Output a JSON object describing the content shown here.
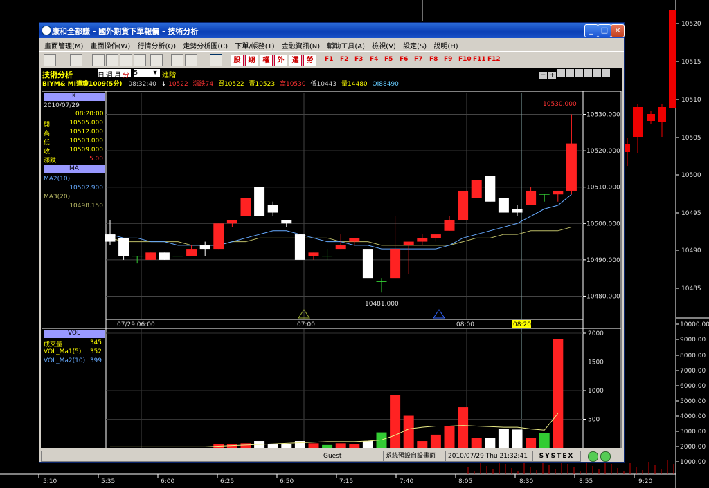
{
  "window": {
    "title": "康和全都賺 - 國外期貨下單報價 - 技術分析",
    "btn_min": "_",
    "btn_max": "□",
    "btn_close": "×"
  },
  "menu": [
    "畫面管理(M)",
    "畫面操作(W)",
    "行情分析(Q)",
    "走勢分析圖(C)",
    "下單/帳務(T)",
    "金融資訊(N)",
    "輔助工具(A)",
    "檢視(V)",
    "設定(S)",
    "說明(H)"
  ],
  "toolbar": {
    "red_buttons": [
      "股",
      "期",
      "權",
      "外",
      "選",
      "勞"
    ],
    "fkeys": [
      "F1",
      "F2",
      "F3",
      "F4",
      "F5",
      "F6",
      "F7",
      "F8",
      "F9",
      "F10",
      "F11",
      "F12"
    ]
  },
  "header": {
    "tech_label": "技術分析",
    "period_options": [
      "日",
      "週",
      "月",
      "分"
    ],
    "period_value": "5",
    "advanced_label": "進階",
    "symbol": "BIYM& MI道瓊1009(5分)",
    "time": "08:32:40",
    "arrow": "↓",
    "last": "10522",
    "chg": "漲跌74",
    "buy": "買10522",
    "sell": "賣10523",
    "high": "高10530",
    "low": "低10443",
    "vol": "量14480",
    "oi": "OI88490"
  },
  "side_panel": {
    "k_title": "K",
    "date": "2010/07/29",
    "time": "08:20:00",
    "rows": [
      {
        "label": "開",
        "value": "10505.000"
      },
      {
        "label": "高",
        "value": "10512.000"
      },
      {
        "label": "低",
        "value": "10503.000"
      },
      {
        "label": "收",
        "value": "10509.000"
      },
      {
        "label": "漲跌",
        "value": "5.00"
      }
    ],
    "ma_title": "MA",
    "ma_rows": [
      {
        "label": "MA2(10)",
        "value": "10502.900"
      },
      {
        "label": "MA3(20)",
        "value": "10498.150"
      }
    ],
    "vol_title": "VOL",
    "vol_rows": [
      {
        "label": "成交量",
        "value": "345"
      },
      {
        "label": "VOL_Ma1(5)",
        "value": "352"
      },
      {
        "label": "VOL_Ma2(10)",
        "value": "399"
      }
    ]
  },
  "status": {
    "user": "Guest",
    "screen": "系統預設自設畫面",
    "datetime": "2010/07/29 Thu 21:32:41",
    "brand": "SYSTEX"
  },
  "chart_data": [
    {
      "type": "candlestick",
      "name": "",
      "y_ticks": [
        "10530.000",
        "10520.000",
        "10510.000",
        "10500.000",
        "10490.000",
        "10480.000"
      ],
      "ylim": [
        10474,
        10536
      ],
      "x_ticks": [
        "07/29 06:00",
        "07:00",
        "08:00",
        "08:20"
      ],
      "annotations": {
        "high": "10530.000",
        "low": "10481.000"
      },
      "candles": [
        {
          "o": 10497,
          "h": 10501,
          "l": 10494,
          "c": 10495
        },
        {
          "o": 10496,
          "h": 10496,
          "l": 10490,
          "c": 10491
        },
        {
          "o": 10491,
          "h": 10491,
          "l": 10489,
          "c": 10491
        },
        {
          "o": 10490,
          "h": 10492,
          "l": 10490,
          "c": 10492
        },
        {
          "o": 10492,
          "h": 10492,
          "l": 10490,
          "c": 10490
        },
        {
          "o": 10491,
          "h": 10491,
          "l": 10491,
          "c": 10491
        },
        {
          "o": 10491,
          "h": 10494,
          "l": 10491,
          "c": 10493
        },
        {
          "o": 10494,
          "h": 10495,
          "l": 10491,
          "c": 10493
        },
        {
          "o": 10493,
          "h": 10500,
          "l": 10493,
          "c": 10500
        },
        {
          "o": 10500,
          "h": 10501,
          "l": 10499,
          "c": 10501
        },
        {
          "o": 10502,
          "h": 10507,
          "l": 10502,
          "c": 10507
        },
        {
          "o": 10510,
          "h": 10510,
          "l": 10502,
          "c": 10502
        },
        {
          "o": 10505,
          "h": 10506,
          "l": 10502,
          "c": 10503
        },
        {
          "o": 10501,
          "h": 10501,
          "l": 10499,
          "c": 10500
        },
        {
          "o": 10497,
          "h": 10497,
          "l": 10490,
          "c": 10490
        },
        {
          "o": 10491,
          "h": 10492,
          "l": 10490,
          "c": 10492
        },
        {
          "o": 10491,
          "h": 10493,
          "l": 10490,
          "c": 10491
        },
        {
          "o": 10493,
          "h": 10497,
          "l": 10493,
          "c": 10494
        },
        {
          "o": 10495,
          "h": 10496,
          "l": 10494,
          "c": 10496
        },
        {
          "o": 10493,
          "h": 10493,
          "l": 10485,
          "c": 10485
        },
        {
          "o": 10484,
          "h": 10485,
          "l": 10481,
          "c": 10484
        },
        {
          "o": 10485,
          "h": 10502,
          "l": 10485,
          "c": 10493
        },
        {
          "o": 10494,
          "h": 10495,
          "l": 10486,
          "c": 10495
        },
        {
          "o": 10495,
          "h": 10497,
          "l": 10494,
          "c": 10496
        },
        {
          "o": 10496,
          "h": 10497,
          "l": 10495,
          "c": 10497
        },
        {
          "o": 10498,
          "h": 10502,
          "l": 10498,
          "c": 10501
        },
        {
          "o": 10501,
          "h": 10509,
          "l": 10501,
          "c": 10509
        },
        {
          "o": 10507,
          "h": 10512,
          "l": 10507,
          "c": 10512
        },
        {
          "o": 10513,
          "h": 10513,
          "l": 10506,
          "c": 10506
        },
        {
          "o": 10507,
          "h": 10507,
          "l": 10503,
          "c": 10503
        },
        {
          "o": 10504,
          "h": 10505,
          "l": 10502,
          "c": 10503
        },
        {
          "o": 10505,
          "h": 10510,
          "l": 10505,
          "c": 10509
        },
        {
          "o": 10508,
          "h": 10508,
          "l": 10506,
          "c": 10508
        },
        {
          "o": 10508,
          "h": 10509,
          "l": 10506,
          "c": 10509
        },
        {
          "o": 10509,
          "h": 10530,
          "l": 10508,
          "c": 10522
        }
      ],
      "ma10": [
        10497,
        10496,
        10496,
        10495,
        10495,
        10494,
        10494,
        10494,
        10494,
        10495,
        10496,
        10497,
        10498,
        10498,
        10497,
        10496,
        10495,
        10495,
        10494,
        10494,
        10493,
        10493,
        10493,
        10493,
        10493,
        10494,
        10496,
        10497,
        10498,
        10499,
        10500,
        10502,
        10504,
        10505,
        10508
      ],
      "ma20": [
        10496,
        10495,
        10495,
        10495,
        10495,
        10495,
        10494,
        10494,
        10494,
        10495,
        10495,
        10496,
        10496,
        10496,
        10496,
        10496,
        10496,
        10495,
        10495,
        10495,
        10494,
        10494,
        10494,
        10494,
        10494,
        10494,
        10495,
        10496,
        10496,
        10497,
        10497,
        10498,
        10498,
        10498,
        10499
      ]
    },
    {
      "type": "bar",
      "name": "VOL",
      "y_ticks": [
        "2000",
        "1500",
        "1000",
        "500"
      ],
      "ylim": [
        0,
        2000
      ],
      "values": [
        0,
        0,
        0,
        0,
        0,
        0,
        0,
        0,
        60,
        60,
        80,
        120,
        60,
        70,
        120,
        80,
        50,
        80,
        60,
        120,
        270,
        920,
        560,
        120,
        230,
        380,
        710,
        170,
        170,
        330,
        320,
        180,
        260,
        1900
      ],
      "vol_ma": [
        20,
        20,
        20,
        20,
        20,
        20,
        20,
        20,
        30,
        40,
        50,
        60,
        70,
        80,
        90,
        100,
        110,
        110,
        110,
        120,
        140,
        220,
        330,
        360,
        380,
        380,
        390,
        380,
        370,
        360,
        360,
        330,
        310,
        600
      ]
    },
    {
      "type": "candlestick",
      "name": "",
      "y_ticks": [
        "10520",
        "10515",
        "10510",
        "10505",
        "10500",
        "10495",
        "10490",
        "10485"
      ],
      "y2_ticks": [
        "10000.00",
        "9000.00",
        "8000.00",
        "7000.00",
        "6000.00",
        "5000.00",
        "4000.00",
        "3000.00",
        "2000.00",
        "1000.00"
      ],
      "x_ticks": [
        "5:10",
        "5:35",
        "6:00",
        "6:25",
        "6:50",
        "7:15",
        "7:40",
        "8:05",
        "8:30",
        "8:55",
        "9:20"
      ]
    }
  ]
}
